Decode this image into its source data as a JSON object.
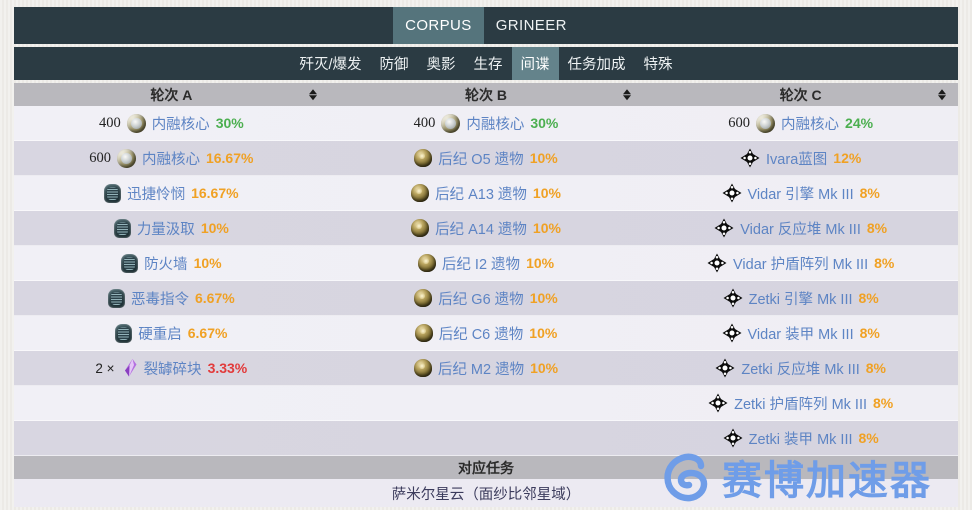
{
  "factions": {
    "tabs": [
      {
        "label": "CORPUS",
        "active": true
      },
      {
        "label": "GRINEER",
        "active": false
      }
    ]
  },
  "mission_types": {
    "tabs": [
      {
        "label": "歼灭/爆发",
        "active": false
      },
      {
        "label": "防御",
        "active": false
      },
      {
        "label": "奥影",
        "active": false
      },
      {
        "label": "生存",
        "active": false
      },
      {
        "label": "间谍",
        "active": true
      },
      {
        "label": "任务加成",
        "active": false
      },
      {
        "label": "特殊",
        "active": false
      }
    ]
  },
  "table": {
    "headers": [
      {
        "label": "轮次 A",
        "sort_icon": "sort-updown-icon"
      },
      {
        "label": "轮次 B",
        "sort_icon": "sort-updown-icon"
      },
      {
        "label": "轮次 C",
        "sort_icon": "sort-updown-icon"
      }
    ],
    "columns": [
      {
        "name": "轮次 A",
        "rows": [
          {
            "qty": "400",
            "icon": "endo",
            "name": "内融核心",
            "pct": "30%",
            "pct_color": "green"
          },
          {
            "qty": "600",
            "icon": "endo",
            "name": "内融核心",
            "pct": "16.67%",
            "pct_color": "orange"
          },
          {
            "qty": "",
            "icon": "mod",
            "name": "迅捷怜悯",
            "pct": "16.67%",
            "pct_color": "orange"
          },
          {
            "qty": "",
            "icon": "mod",
            "name": "力量汲取",
            "pct": "10%",
            "pct_color": "orange"
          },
          {
            "qty": "",
            "icon": "mod",
            "name": "防火墙",
            "pct": "10%",
            "pct_color": "orange"
          },
          {
            "qty": "",
            "icon": "mod",
            "name": "恶毒指令",
            "pct": "6.67%",
            "pct_color": "orange"
          },
          {
            "qty": "",
            "icon": "mod",
            "name": "硬重启",
            "pct": "6.67%",
            "pct_color": "orange"
          },
          {
            "mult": "2 ×",
            "icon": "shard",
            "name": "裂罅碎块",
            "pct": "3.33%",
            "pct_color": "red"
          },
          {
            "empty": true
          },
          {
            "empty": true
          }
        ]
      },
      {
        "name": "轮次 B",
        "rows": [
          {
            "qty": "400",
            "icon": "endo",
            "name": "内融核心",
            "pct": "30%",
            "pct_color": "green"
          },
          {
            "qty": "",
            "icon": "relic",
            "name": "后纪 O5 遗物",
            "pct": "10%",
            "pct_color": "orange"
          },
          {
            "qty": "",
            "icon": "relic",
            "name": "后纪 A13 遗物",
            "pct": "10%",
            "pct_color": "orange"
          },
          {
            "qty": "",
            "icon": "relic",
            "name": "后纪 A14 遗物",
            "pct": "10%",
            "pct_color": "orange"
          },
          {
            "qty": "",
            "icon": "relic",
            "name": "后纪 I2 遗物",
            "pct": "10%",
            "pct_color": "orange"
          },
          {
            "qty": "",
            "icon": "relic",
            "name": "后纪 G6 遗物",
            "pct": "10%",
            "pct_color": "orange"
          },
          {
            "qty": "",
            "icon": "relic",
            "name": "后纪 C6 遗物",
            "pct": "10%",
            "pct_color": "orange"
          },
          {
            "qty": "",
            "icon": "relic",
            "name": "后纪 M2 遗物",
            "pct": "10%",
            "pct_color": "orange"
          },
          {
            "empty": true
          },
          {
            "empty": true
          }
        ]
      },
      {
        "name": "轮次 C",
        "rows": [
          {
            "qty": "600",
            "icon": "endo",
            "name": "内融核心",
            "pct": "24%",
            "pct_color": "green"
          },
          {
            "qty": "",
            "icon": "rjpart",
            "name": "Ivara蓝图",
            "pct": "12%",
            "pct_color": "orange"
          },
          {
            "qty": "",
            "icon": "rjpart",
            "name": "Vidar 引擎 Mk III",
            "pct": "8%",
            "pct_color": "orange"
          },
          {
            "qty": "",
            "icon": "rjpart",
            "name": "Vidar 反应堆 Mk III",
            "pct": "8%",
            "pct_color": "orange"
          },
          {
            "qty": "",
            "icon": "rjpart",
            "name": "Vidar 护盾阵列 Mk III",
            "pct": "8%",
            "pct_color": "orange"
          },
          {
            "qty": "",
            "icon": "rjpart",
            "name": "Zetki 引擎 Mk III",
            "pct": "8%",
            "pct_color": "orange"
          },
          {
            "qty": "",
            "icon": "rjpart",
            "name": "Vidar 装甲 Mk III",
            "pct": "8%",
            "pct_color": "orange"
          },
          {
            "qty": "",
            "icon": "rjpart",
            "name": "Zetki 反应堆 Mk III",
            "pct": "8%",
            "pct_color": "orange"
          },
          {
            "qty": "",
            "icon": "rjpart",
            "name": "Zetki 护盾阵列 Mk III",
            "pct": "8%",
            "pct_color": "orange"
          },
          {
            "qty": "",
            "icon": "rjpart",
            "name": "Zetki 装甲 Mk III",
            "pct": "8%",
            "pct_color": "orange"
          }
        ]
      }
    ]
  },
  "footer": {
    "heading": "对应任务",
    "mission": "萨米尔星云（面纱比邻星域）"
  },
  "watermark": {
    "text": "赛博加速器",
    "logo": "s-circle-logo",
    "color": "#6f9de8"
  },
  "colors": {
    "nav_bg": "#2b3b43",
    "nav_active": "#64838b",
    "header_bg": "#b9b8bd",
    "row_odd": "#f0eff5",
    "row_even": "#d7d5e0",
    "item_name": "#5d84c4",
    "pct_green": "#4caf50",
    "pct_orange": "#f0a124",
    "pct_red": "#e23b3b"
  }
}
